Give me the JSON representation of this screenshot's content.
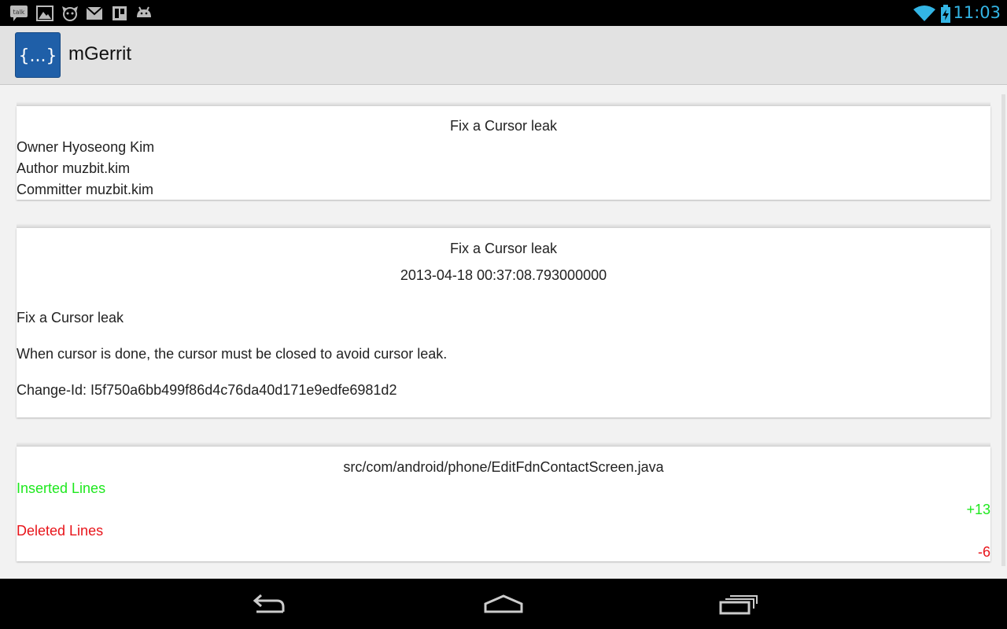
{
  "status_bar": {
    "time": "11:03",
    "notification_icons": [
      "talk-icon",
      "gallery-icon",
      "dog-icon",
      "gmail-icon",
      "trello-icon",
      "android-icon"
    ],
    "talk_label": "talk"
  },
  "app_bar": {
    "title": "mGerrit",
    "logo_text": "{...}"
  },
  "change_info": {
    "title": "Fix a Cursor leak",
    "owner_label": "Owner",
    "owner_value": "Hyoseong Kim",
    "author_label": "Author",
    "author_value": "muzbit.kim",
    "committer_label": "Committer",
    "committer_value": "muzbit.kim"
  },
  "commit": {
    "title": "Fix a Cursor leak",
    "timestamp": "2013-04-18 00:37:08.793000000",
    "message_line1": "Fix a Cursor leak",
    "message_line2": "When cursor is done, the cursor must be closed to avoid cursor leak.",
    "change_id": "Change-Id: I5f750a6bb499f86d4c76da40d171e9edfe6981d2"
  },
  "file_change": {
    "path": "src/com/android/phone/EditFdnContactScreen.java",
    "inserted_label": "Inserted Lines",
    "inserted_value": "+13",
    "deleted_label": "Deleted Lines",
    "deleted_value": "-6"
  },
  "colors": {
    "accent_blue": "#33b5e5",
    "inserted_green": "#1ee81e",
    "deleted_red": "#e8141a",
    "logo_blue": "#1f5fa8"
  },
  "nav_bar": {
    "icons": [
      "back-icon",
      "home-icon",
      "recents-icon"
    ]
  }
}
